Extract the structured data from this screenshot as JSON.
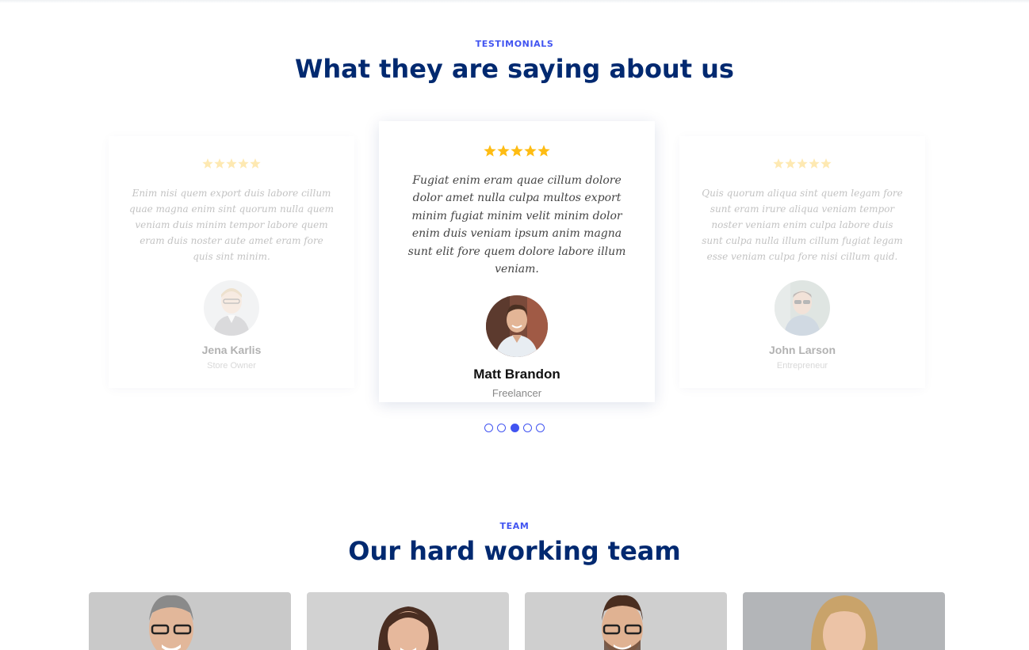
{
  "testimonials": {
    "label": "TESTIMONIALS",
    "title": "What they are saying about us",
    "star_color": "#febc13",
    "items": [
      {
        "quote": "Enim nisi quem export duis labore cillum quae magna enim sint quorum nulla quem veniam duis minim tempor labore quem eram duis noster aute amet eram fore quis sint minim.",
        "name": "Jena Karlis",
        "role": "Store Owner",
        "rating": 5
      },
      {
        "quote": "Fugiat enim eram quae cillum dolore dolor amet nulla culpa multos export minim fugiat minim velit minim dolor enim duis veniam ipsum anim magna sunt elit fore quem dolore labore illum veniam.",
        "name": "Matt Brandon",
        "role": "Freelancer",
        "rating": 5
      },
      {
        "quote": "Quis quorum aliqua sint quem legam fore sunt eram irure aliqua veniam tempor noster veniam enim culpa labore duis sunt culpa nulla illum cillum fugiat legam esse veniam culpa fore nisi cillum quid.",
        "name": "John Larson",
        "role": "Entrepreneur",
        "rating": 5
      }
    ],
    "pagination": {
      "count": 5,
      "active_index": 2
    }
  },
  "team": {
    "label": "TEAM",
    "title": "Our hard working team",
    "members": 4
  },
  "colors": {
    "accent": "#4154f1",
    "heading": "#012970"
  }
}
